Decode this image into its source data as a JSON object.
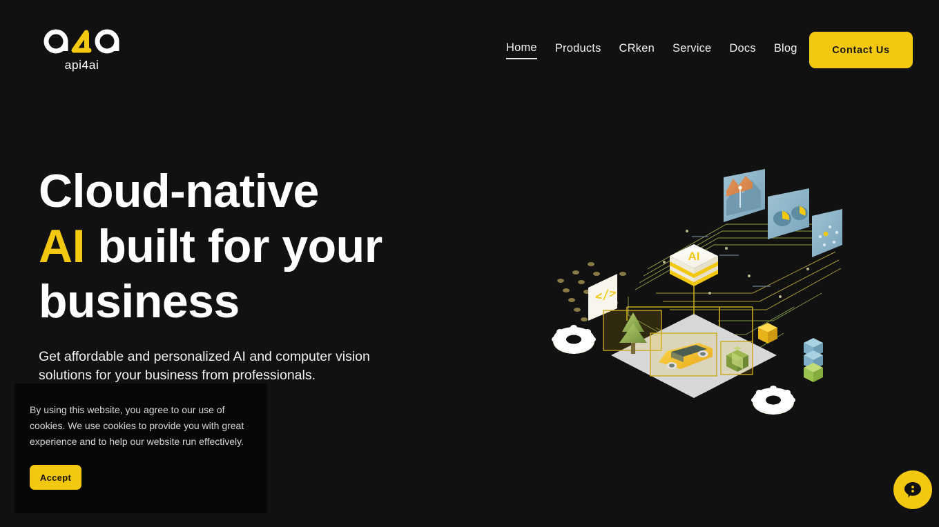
{
  "brand": {
    "logo_text": "a4a",
    "logo_wordmark": "api4ai",
    "accent_color": "#F2C811",
    "background_color": "#111111"
  },
  "header": {
    "nav": [
      {
        "label": "Home",
        "active": true
      },
      {
        "label": "Products",
        "active": false
      },
      {
        "label": "CRken",
        "active": false
      },
      {
        "label": "Service",
        "active": false
      },
      {
        "label": "Docs",
        "active": false
      },
      {
        "label": "Blog",
        "active": false
      }
    ],
    "cta_label": "Contact Us"
  },
  "hero": {
    "title_line1": "Cloud-native",
    "title_accent": "AI",
    "title_line2_rest": " built for your",
    "title_line3": "business",
    "subtitle": "Get affordable and personalized AI and computer vision solutions for your business from professionals."
  },
  "cookie_banner": {
    "text": "By using this website, you agree to our use of cookies. We use cookies to provide you with great experience and to help our website run effectively.",
    "accept_label": "Accept"
  },
  "chat_widget": {
    "icon": "chat-bubble-icon",
    "label": ""
  },
  "illustration": {
    "name": "isometric-ai-computer-vision-scene",
    "ai_cube_label": "AI",
    "code_card_label": "</>",
    "elements": [
      "ai-cube",
      "code-card",
      "dot-grid",
      "dashboard-panel-area-chart",
      "dashboard-panel-pie-chart",
      "dashboard-panel-scatter",
      "circuit-plane",
      "detection-platform",
      "car",
      "tree",
      "gift-box",
      "yellow-cube",
      "stacked-cubes",
      "gear-left",
      "gear-bottom"
    ]
  }
}
